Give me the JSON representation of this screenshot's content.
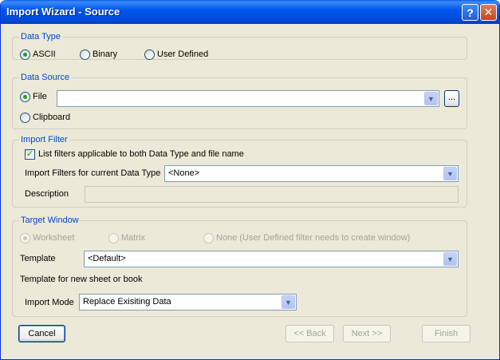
{
  "window": {
    "title": "Import Wizard - Source",
    "help_label": "?",
    "close_label": "✕"
  },
  "data_type": {
    "legend": "Data Type",
    "options": [
      {
        "label": "ASCII",
        "checked": true
      },
      {
        "label": "Binary",
        "checked": false
      },
      {
        "label": "User Defined",
        "checked": false
      }
    ]
  },
  "data_source": {
    "legend": "Data Source",
    "file_label": "File",
    "file_value": "",
    "browse_label": "...",
    "clipboard_label": "Clipboard"
  },
  "import_filter": {
    "legend": "Import Filter",
    "checkbox_label": "List filters applicable to both Data Type and file name",
    "checkbox_checked": true,
    "filters_label": "Import Filters for current Data Type",
    "filters_value": "<None>",
    "description_label": "Description",
    "description_value": ""
  },
  "target_window": {
    "legend": "Target Window",
    "options": [
      {
        "label": "Worksheet",
        "checked": true,
        "disabled": true
      },
      {
        "label": "Matrix",
        "checked": false,
        "disabled": true
      },
      {
        "label": "None (User Defined filter needs to create window)",
        "checked": false,
        "disabled": true
      }
    ],
    "template_label": "Template",
    "template_value": "<Default>",
    "template_hint": "Template for new sheet or book",
    "import_mode_label": "Import Mode",
    "import_mode_value": "Replace Exisiting Data"
  },
  "footer": {
    "cancel_label": "Cancel",
    "back_label": "<< Back",
    "next_label": "Next >>",
    "finish_label": "Finish"
  },
  "icons": {
    "dropdown": "chevron-down-icon",
    "check": "check-icon"
  },
  "colors": {
    "title_bar": "#0058ee",
    "legend_text": "#0046d5",
    "radio_dot": "#21a121",
    "face": "#ece9d8"
  }
}
